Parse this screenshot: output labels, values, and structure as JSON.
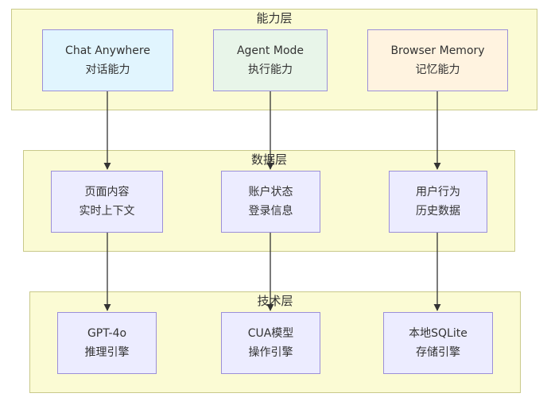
{
  "layers": [
    {
      "title": "能力层",
      "nodes": [
        {
          "line1": "Chat Anywhere",
          "line2": "对话能力",
          "fill": "#e1f5fe"
        },
        {
          "line1": "Agent Mode",
          "line2": "执行能力",
          "fill": "#e8f5e9"
        },
        {
          "line1": "Browser Memory",
          "line2": "记忆能力",
          "fill": "#fff3e0"
        }
      ]
    },
    {
      "title": "数据层",
      "nodes": [
        {
          "line1": "页面内容",
          "line2": "实时上下文",
          "fill": "#ececff"
        },
        {
          "line1": "账户状态",
          "line2": "登录信息",
          "fill": "#ececff"
        },
        {
          "line1": "用户行为",
          "line2": "历史数据",
          "fill": "#ececff"
        }
      ]
    },
    {
      "title": "技术层",
      "nodes": [
        {
          "line1": "GPT-4o",
          "line2": "推理引擎",
          "fill": "#ececff"
        },
        {
          "line1": "CUA模型",
          "line2": "操作引擎",
          "fill": "#ececff"
        },
        {
          "line1": "本地SQLite",
          "line2": "存储引擎",
          "fill": "#ececff"
        }
      ]
    }
  ],
  "colors": {
    "layer_fill": "#fbfbd4",
    "layer_border": "#c9c98a",
    "node_border": "#9b8fd9",
    "edge": "#333333"
  }
}
